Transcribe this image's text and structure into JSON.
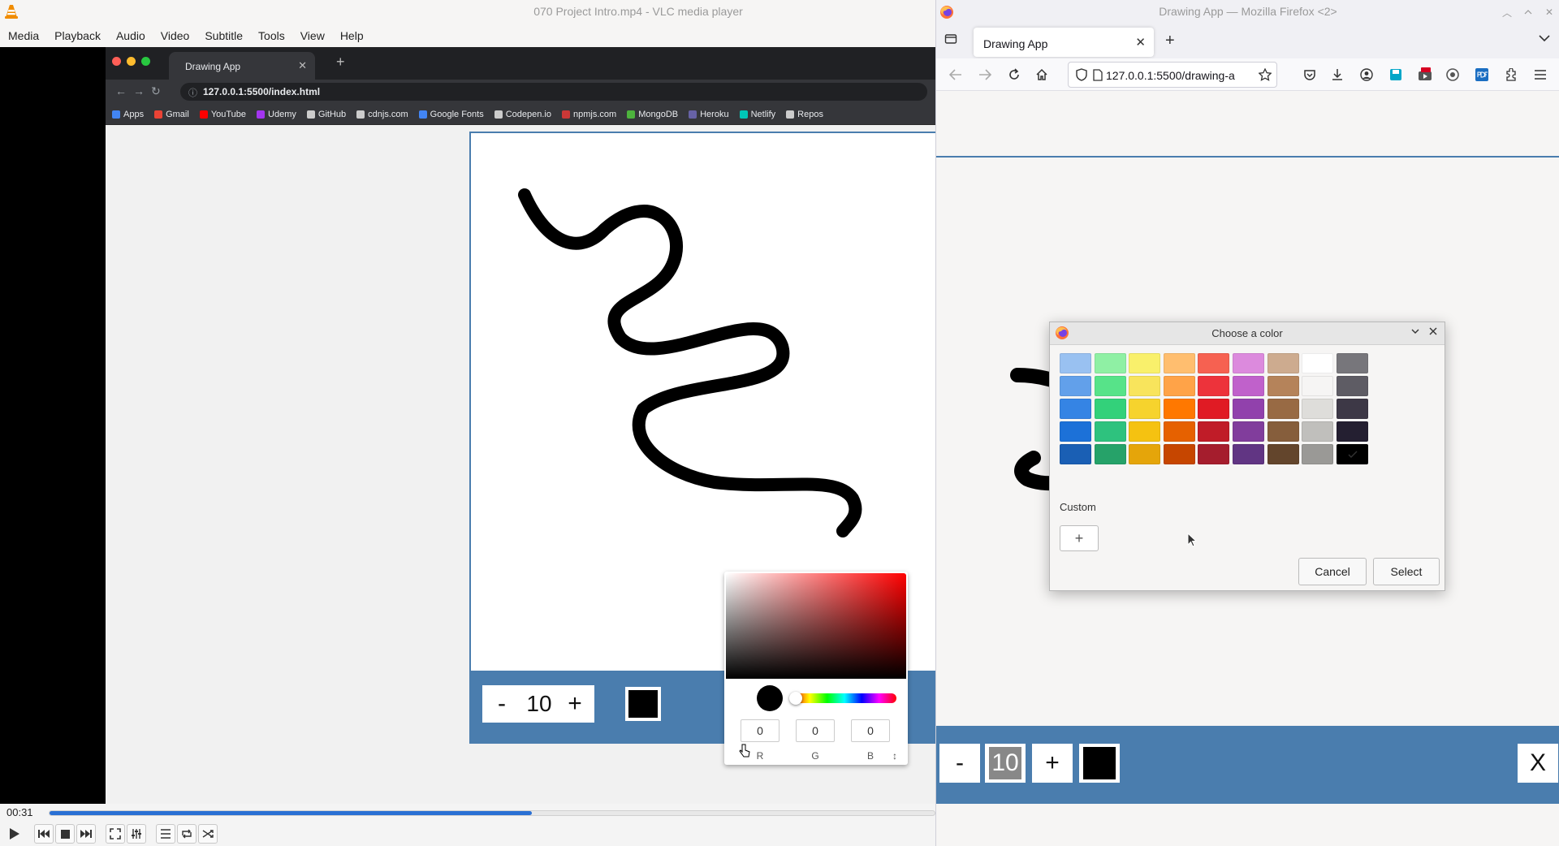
{
  "vlc": {
    "title": "070 Project Intro.mp4 - VLC media player",
    "menu": [
      "Media",
      "Playback",
      "Audio",
      "Video",
      "Subtitle",
      "Tools",
      "View",
      "Help"
    ],
    "time_elapsed": "00:31",
    "progress": 0.545
  },
  "video": {
    "tab_title": "Drawing App",
    "url": "127.0.0.1:5500/index.html",
    "bookmarks": [
      "Apps",
      "Gmail",
      "YouTube",
      "Udemy",
      "GitHub",
      "cdnjs.com",
      "Google Fonts",
      "Codepen.io",
      "npmjs.com",
      "MongoDB",
      "Heroku",
      "Netlify",
      "Repos"
    ],
    "bookmark_colors": [
      "#4285f4",
      "#ea4335",
      "#ff0000",
      "#a435f0",
      "#cccccc",
      "#cccccc",
      "#4285f4",
      "#cccccc",
      "#cb3837",
      "#4db33d",
      "#6762a6",
      "#00c7b7",
      "#cccccc"
    ],
    "toolbar": {
      "minus": "-",
      "size": "10",
      "plus": "+"
    },
    "picker": {
      "r": "0",
      "g": "0",
      "b": "0",
      "label_r": "R",
      "label_g": "G",
      "label_b": "B",
      "label_toggle": "↕"
    }
  },
  "firefox": {
    "window_title": "Drawing App — Mozilla Firefox <2>",
    "tab_title": "Drawing App",
    "url": "127.0.0.1:5500/drawing-a",
    "toolbar": {
      "minus": "-",
      "size": "10",
      "plus": "+",
      "clear": "X"
    }
  },
  "dialog": {
    "title": "Choose a color",
    "custom_label": "Custom",
    "add_label": "+",
    "cancel": "Cancel",
    "select": "Select",
    "selected_color": "#000000",
    "palette": [
      [
        "#99c1f1",
        "#8ff0a4",
        "#f9f06b",
        "#ffbe6f",
        "#f66151",
        "#dc8add",
        "#cdab8f",
        "#ffffff",
        "#77767b"
      ],
      [
        "#62a0ea",
        "#57e389",
        "#f8e45c",
        "#ffa348",
        "#ed333b",
        "#c061cb",
        "#b5835a",
        "#f6f5f4",
        "#5e5c64"
      ],
      [
        "#3584e4",
        "#33d17a",
        "#f6d32d",
        "#ff7800",
        "#e01b24",
        "#9141ac",
        "#986a44",
        "#deddda",
        "#3d3846"
      ],
      [
        "#1c71d8",
        "#2ec27e",
        "#f5c211",
        "#e66100",
        "#c01c28",
        "#813d9c",
        "#865e3c",
        "#c0bfbc",
        "#241f31"
      ],
      [
        "#1a5fb4",
        "#26a269",
        "#e5a50a",
        "#c64600",
        "#a51d2d",
        "#613583",
        "#63452c",
        "#9a9996",
        "#000000"
      ]
    ]
  }
}
